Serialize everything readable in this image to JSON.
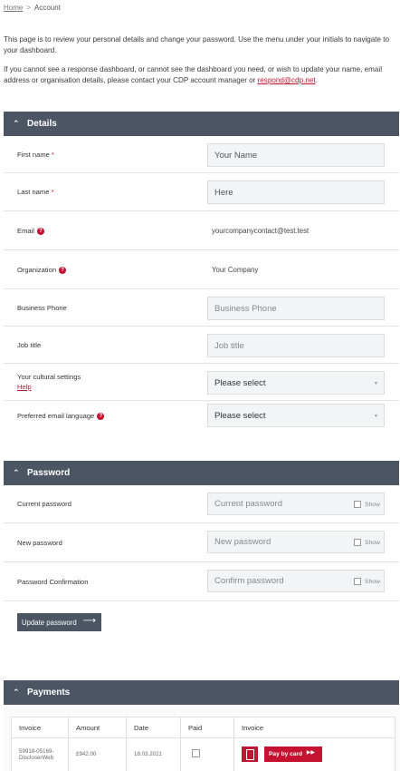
{
  "breadcrumb": {
    "home": "Home",
    "separator": ">",
    "current": "Account"
  },
  "intro": {
    "para1": "This page is to review your personal details and change your password. Use the menu under your initials to navigate to your dashboard.",
    "para2_prefix": "If you cannot see a response dashboard, or cannot see the dashboard you need, or wish to update your name, email address or organisation details, please contact your CDP account manager or ",
    "para2_link": "respond@cdp.net",
    "para2_suffix": "."
  },
  "details": {
    "title": "Details",
    "first_name_label": "First name",
    "first_name_value": "Your Name",
    "last_name_label": "Last name",
    "last_name_value": "Here",
    "required_mark": "*",
    "email_label": "Email",
    "email_value": "yourcompanycontact@test.test",
    "org_label": "Organization",
    "org_value": "Your Company",
    "phone_label": "Business Phone",
    "phone_placeholder": "Business Phone",
    "job_label": "Job title",
    "job_placeholder": "Job title",
    "cultural_label": "Your cultural settings",
    "cultural_help": "Help",
    "cultural_value": "Please select",
    "email_lang_label": "Preferred email language",
    "email_lang_value": "Please select",
    "help_glyph": "?"
  },
  "password": {
    "title": "Password",
    "current_label": "Current password",
    "current_placeholder": "Current password",
    "new_label": "New password",
    "new_placeholder": "New password",
    "confirm_label": "Password Confirmation",
    "confirm_placeholder": "Confirm password",
    "show_label": "Show",
    "update_button": "Update password"
  },
  "payments": {
    "title": "Payments",
    "columns": [
      "Invoice",
      "Amount",
      "Date",
      "Paid",
      "Invoice"
    ],
    "rows": [
      {
        "invoice": "59918-05169-DiscloserWeb",
        "amount": "£942.00",
        "date": "18.03.2021",
        "pay_button": "Pay by card"
      }
    ]
  },
  "colors": {
    "header_bg": "#4b5563",
    "accent": "#c41230",
    "field_bg": "#f3f4f5"
  }
}
